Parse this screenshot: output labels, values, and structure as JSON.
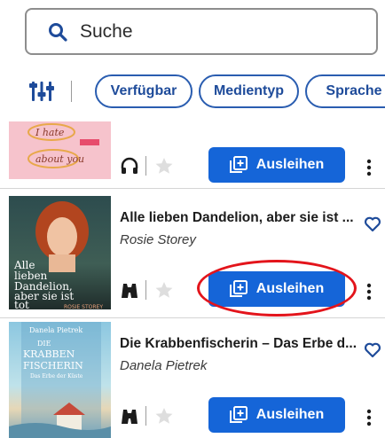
{
  "search": {
    "placeholder": "Suche"
  },
  "filters": {
    "chips": [
      "Verfügbar",
      "Medientyp",
      "Sprache"
    ]
  },
  "books": [
    {
      "title": "",
      "author": "",
      "cover_text": "I hate ... about you",
      "format_icon": "headphones-icon",
      "borrow_label": "Ausleihen",
      "has_heart": false
    },
    {
      "title": "Alle lieben Dandelion, aber sie ist ...",
      "author": "Rosie Storey",
      "cover_title": "Alle lieben Dandelion, aber sie ist tot",
      "cover_author": "ROSIE STOREY",
      "format_icon": "binoculars-icon",
      "borrow_label": "Ausleihen",
      "has_heart": true
    },
    {
      "title": "Die Krabbenfischerin – Das Erbe d...",
      "author": "Danela Pietrek",
      "cover_author": "Danela Pietrek",
      "cover_title": "DIE KRABBEN FISCHERIN",
      "cover_subtitle": "Das Erbe der Küste",
      "format_icon": "binoculars-icon",
      "borrow_label": "Ausleihen",
      "has_heart": true
    }
  ],
  "colors": {
    "accent": "#1565d8",
    "chip_border": "#2a5db0",
    "highlight": "#e3141b"
  }
}
